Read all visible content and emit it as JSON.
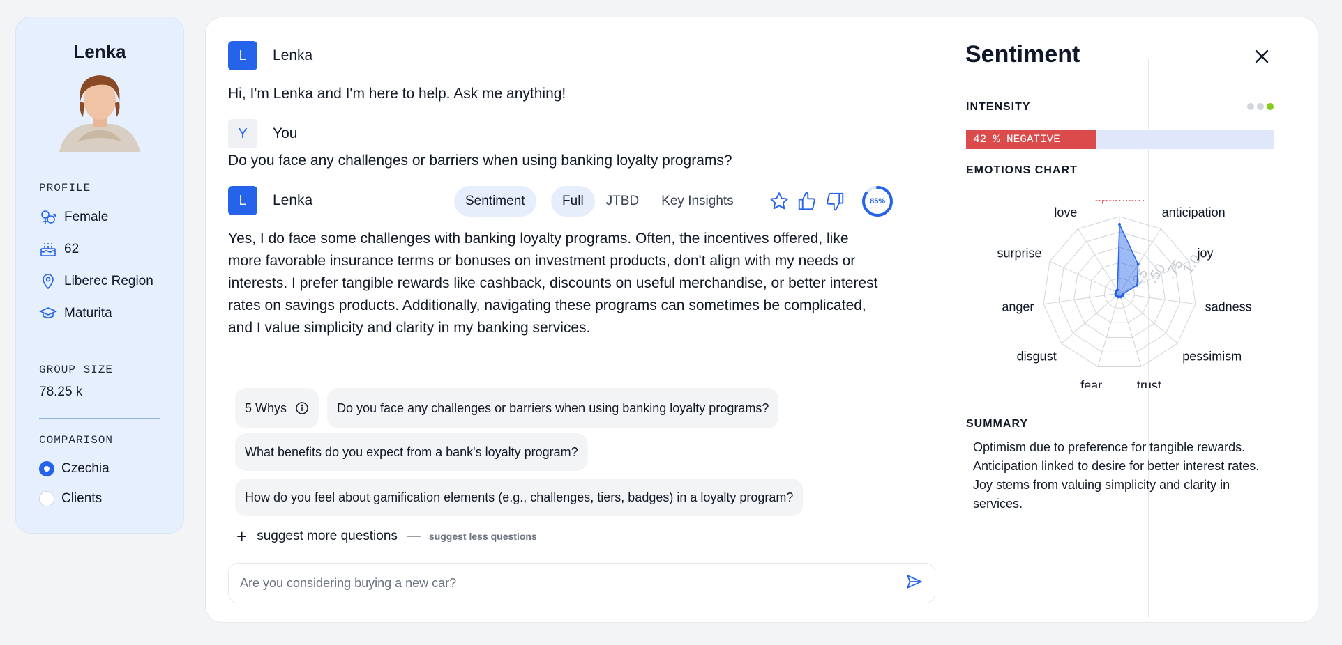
{
  "persona": {
    "name": "Lenka",
    "profile_label": "PROFILE",
    "profile": [
      {
        "icon": "gender-icon",
        "text": "Female"
      },
      {
        "icon": "cake-icon",
        "text": "62"
      },
      {
        "icon": "location-pin-icon",
        "text": "Liberec Region"
      },
      {
        "icon": "graduation-cap-icon",
        "text": "Maturita"
      }
    ],
    "group_size_label": "GROUP SIZE",
    "group_size_value": "78.25 k",
    "comparison_label": "COMPARISON",
    "comparison_options": [
      "Czechia",
      "Clients"
    ],
    "comparison_selected": "Czechia"
  },
  "chat": {
    "messages": [
      {
        "sender": "Lenka",
        "avatar": "L",
        "text": "Hi, I'm Lenka and I'm here to help. Ask me anything!"
      },
      {
        "sender": "You",
        "avatar": "Y",
        "text": "Do you face any challenges or barriers when using banking loyalty programs?"
      },
      {
        "sender": "Lenka",
        "avatar": "L",
        "lines": [
          "Yes, I do face some challenges with banking loyalty programs. Often, the incentives offered, like",
          "more favorable insurance terms or bonuses on investment products, don't align with my needs or",
          "interests. I prefer tangible rewards like cashback, discounts on useful merchandise, or better interest",
          "rates on savings products. Additionally, navigating these programs can sometimes be complicated,",
          "and I value simplicity and clarity in my banking services."
        ]
      }
    ],
    "toolbar": {
      "sentiment": "Sentiment",
      "full": "Full",
      "jtbd": "JTBD",
      "key_insights": "Key Insights",
      "confidence": "85%",
      "confidence_value": 0.85
    },
    "suggestions": {
      "whys_label": "5 Whys",
      "items": [
        "Do you face any challenges or barriers when using banking loyalty programs?",
        "What benefits do you expect from a bank's loyalty program?",
        "How do you feel about gamification elements (e.g., challenges, tiers, badges) in a loyalty program?"
      ],
      "more": "suggest more questions",
      "less": "suggest less questions"
    },
    "input_placeholder": "Are you considering buying a new car?"
  },
  "sentiment": {
    "title": "Sentiment",
    "intensity_label": "INTENSITY",
    "intensity_text": "42 % NEGATIVE",
    "intensity_value": 0.42,
    "emotions_label": "EMOTIONS CHART",
    "summary_label": "SUMMARY",
    "summary": [
      "Optimism due to preference for tangible rewards.",
      "Anticipation linked to desire for better interest rates.",
      "Joy stems from valuing simplicity and clarity in services."
    ],
    "colors": {
      "negative": "#dc4b4b",
      "accent": "#2563eb",
      "highlight": "#dc4b4b"
    }
  },
  "chart_data": {
    "type": "radar",
    "categories": [
      "optimism",
      "anticipation",
      "joy",
      "sadness",
      "pessimism",
      "trust",
      "fear",
      "disgust",
      "anger",
      "surprise",
      "love"
    ],
    "values": [
      0.9,
      0.45,
      0.25,
      0.05,
      0.05,
      0.05,
      0.05,
      0.05,
      0.05,
      0.05,
      0.05
    ],
    "highlighted": "optimism",
    "rlim": [
      0,
      1
    ],
    "tick_labels": [
      ".25",
      ".50",
      ".75",
      "1.0"
    ]
  }
}
